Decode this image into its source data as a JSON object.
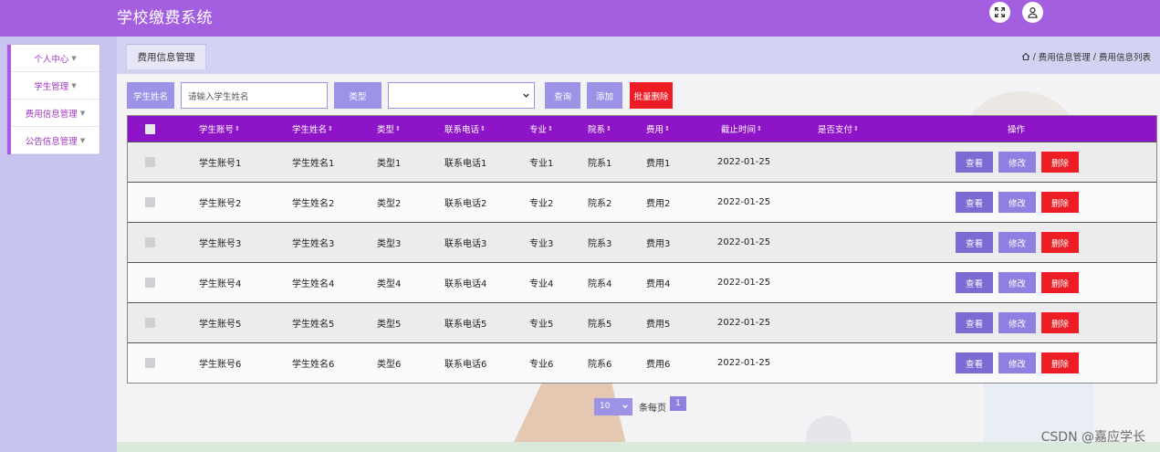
{
  "app": {
    "title": "学校缴费系统"
  },
  "header": {
    "icons": [
      "fullscreen-icon",
      "user-icon"
    ]
  },
  "sidebar": {
    "items": [
      {
        "label": "个人中心"
      },
      {
        "label": "学生管理"
      },
      {
        "label": "费用信息管理"
      },
      {
        "label": "公告信息管理"
      }
    ]
  },
  "page": {
    "tab": "费用信息管理",
    "breadcrumb": {
      "home_icon": "home-icon",
      "level1": "费用信息管理",
      "sep": "/",
      "level2": "费用信息列表"
    }
  },
  "search": {
    "name_label": "学生姓名",
    "name_placeholder": "请输入学生姓名",
    "type_label": "类型",
    "type_value": "",
    "query_button": "查询",
    "add_button": "添加",
    "batch_delete_button": "批量删除"
  },
  "table": {
    "columns": [
      "学生账号",
      "学生姓名",
      "类型",
      "联系电话",
      "专业",
      "院系",
      "费用",
      "截止时间",
      "是否支付",
      "操作"
    ],
    "rows": [
      {
        "account": "学生账号1",
        "name": "学生姓名1",
        "type": "类型1",
        "phone": "联系电话1",
        "major": "专业1",
        "dept": "院系1",
        "fee": "费用1",
        "deadline": "2022-01-25",
        "paid": ""
      },
      {
        "account": "学生账号2",
        "name": "学生姓名2",
        "type": "类型2",
        "phone": "联系电话2",
        "major": "专业2",
        "dept": "院系2",
        "fee": "费用2",
        "deadline": "2022-01-25",
        "paid": ""
      },
      {
        "account": "学生账号3",
        "name": "学生姓名3",
        "type": "类型3",
        "phone": "联系电话3",
        "major": "专业3",
        "dept": "院系3",
        "fee": "费用3",
        "deadline": "2022-01-25",
        "paid": ""
      },
      {
        "account": "学生账号4",
        "name": "学生姓名4",
        "type": "类型4",
        "phone": "联系电话4",
        "major": "专业4",
        "dept": "院系4",
        "fee": "费用4",
        "deadline": "2022-01-25",
        "paid": ""
      },
      {
        "account": "学生账号5",
        "name": "学生姓名5",
        "type": "类型5",
        "phone": "联系电话5",
        "major": "专业5",
        "dept": "院系5",
        "fee": "费用5",
        "deadline": "2022-01-25",
        "paid": ""
      },
      {
        "account": "学生账号6",
        "name": "学生姓名6",
        "type": "类型6",
        "phone": "联系电话6",
        "major": "专业6",
        "dept": "院系6",
        "fee": "费用6",
        "deadline": "2022-01-25",
        "paid": ""
      }
    ],
    "actions": {
      "view": "查看",
      "edit": "修改",
      "delete": "删除"
    }
  },
  "pagination": {
    "page_size": "10",
    "page_size_label": "条每页",
    "current_page": "1"
  },
  "watermark": "CSDN @嘉应学长",
  "colors": {
    "header": "#a35fe0",
    "sidebar": "#c8c6f0",
    "table_header": "#8e14c7",
    "button": "#9d93e6",
    "danger": "#ee1c24"
  }
}
